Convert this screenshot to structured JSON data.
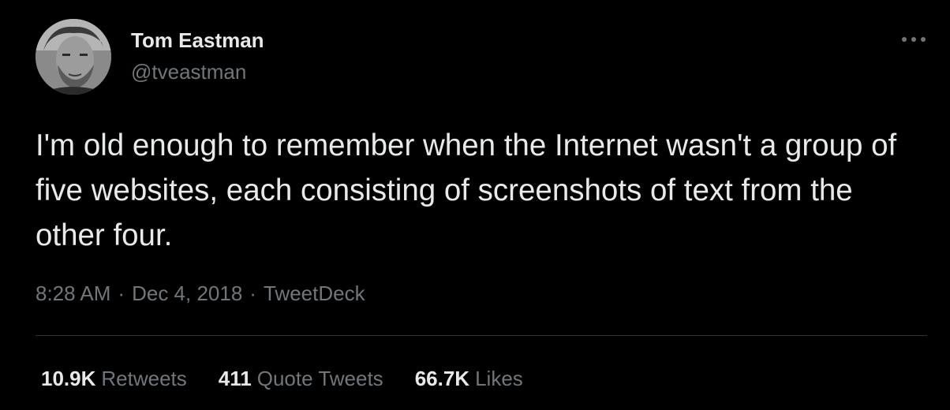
{
  "author": {
    "display_name": "Tom Eastman",
    "handle": "@tveastman",
    "avatar_icon": "profile-photo"
  },
  "more_icon": "more-options-icon",
  "tweet": {
    "text": "I'm old enough to remember when the Internet wasn't a group of five websites, each consisting of screenshots of text from the other four."
  },
  "meta": {
    "time": "8:28 AM",
    "separator": "·",
    "date": "Dec 4, 2018",
    "source": "TweetDeck"
  },
  "stats": {
    "retweets": {
      "count": "10.9K",
      "label": "Retweets"
    },
    "quotes": {
      "count": "411",
      "label": "Quote Tweets"
    },
    "likes": {
      "count": "66.7K",
      "label": "Likes"
    }
  },
  "colors": {
    "background": "#000000",
    "primary_text": "#e7e9ea",
    "secondary_text": "#71767b",
    "divider": "#2f3336"
  }
}
